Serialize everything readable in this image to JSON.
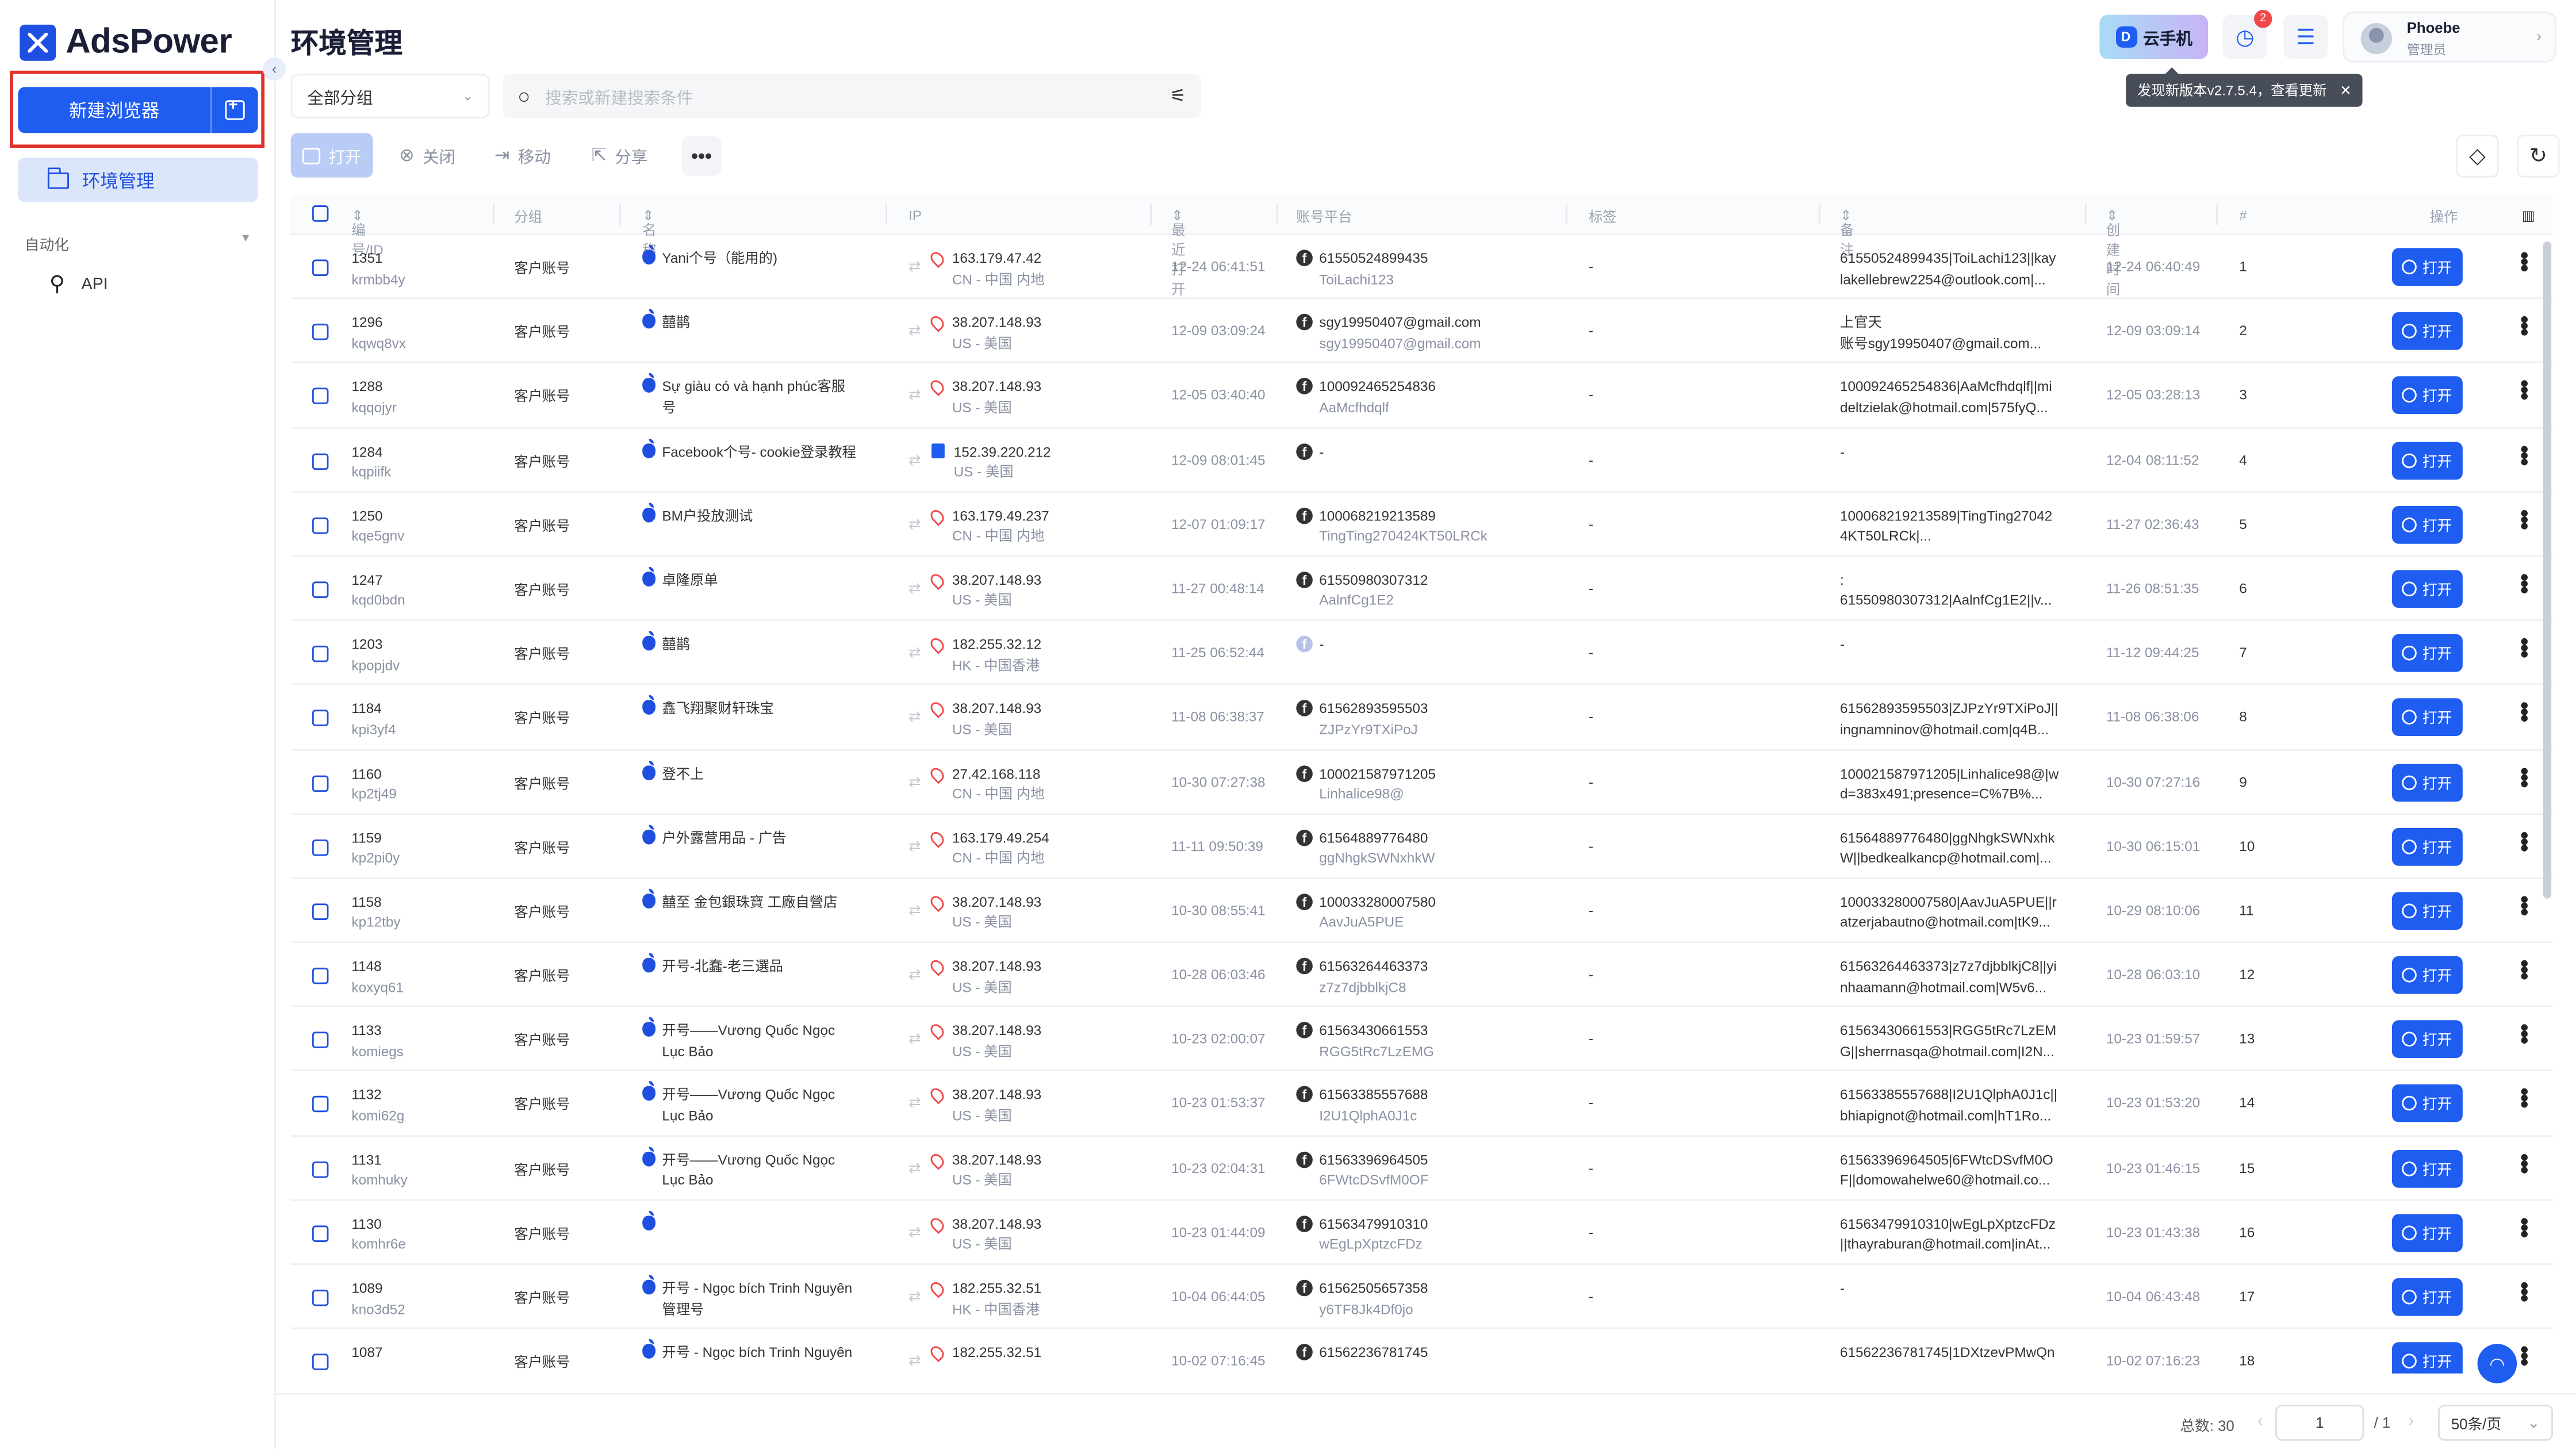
{
  "app": {
    "logo_text": "AdsPower",
    "page_title": "环境管理"
  },
  "sidebar": {
    "new_browser_label": "新建浏览器",
    "env_mgmt_label": "环境管理",
    "automation_label": "自动化",
    "api_label": "API"
  },
  "header": {
    "cloud_phone_label": "云手机",
    "notif_count": "2",
    "user_name": "Phoebe",
    "user_role": "管理员",
    "update_tip": "发现新版本v2.7.5.4，查看更新"
  },
  "filter": {
    "group_select": "全部分组",
    "search_placeholder": "搜索或新建搜索条件"
  },
  "actions": {
    "open": "打开",
    "close": "关闭",
    "move": "移动",
    "share": "分享"
  },
  "columns": {
    "id": "编号/ID",
    "group": "分组",
    "name": "名称",
    "ip": "IP",
    "last_open": "最近打开",
    "account": "账号平台",
    "tag": "标签",
    "note": "备注",
    "created": "创建时间",
    "num": "#",
    "ops": "操作"
  },
  "open_btn_label": "打开",
  "rows": [
    {
      "id": "1351",
      "uid": "krmbb4y",
      "group": "客户账号",
      "name": "Yani个号（能用的)",
      "ip": "163.179.47.42",
      "region": "CN - 中国 内地",
      "last": "12-24 06:41:51",
      "acct": "61550524899435",
      "acct_sub": "ToiLachi123",
      "tag": "-",
      "note1": "61550524899435|ToiLachi123||kay",
      "note2": "lakellebrew2254@outlook.com|...",
      "created": "12-24 06:40:49",
      "num": "1"
    },
    {
      "id": "1296",
      "uid": "kqwq8vx",
      "group": "客户账号",
      "name": "囍鹊",
      "ip": "38.207.148.93",
      "region": "US - 美国",
      "last": "12-09 03:09:24",
      "acct": "sgy19950407@gmail.com",
      "acct_sub": "sgy19950407@gmail.com",
      "tag": "-",
      "note1": "上官天",
      "note2": "账号sgy19950407@gmail.com...",
      "created": "12-09 03:09:14",
      "num": "2"
    },
    {
      "id": "1288",
      "uid": "kqqojyr",
      "group": "客户账号",
      "name": "Sự giàu có và hạnh phúc客服号",
      "ip": "38.207.148.93",
      "region": "US - 美国",
      "last": "12-05 03:40:40",
      "acct": "100092465254836",
      "acct_sub": "AaMcfhdqlf",
      "tag": "-",
      "note1": "100092465254836|AaMcfhdqlf||mi",
      "note2": "deltzielak@hotmail.com|575fyQ...",
      "created": "12-05 03:28:13",
      "num": "3"
    },
    {
      "id": "1284",
      "uid": "kqpiifk",
      "group": "客户账号",
      "name": "Facebook个号- cookie登录教程",
      "ip": "152.39.220.212",
      "region": "US - 美国",
      "last": "12-09 08:01:45",
      "acct": "-",
      "acct_sub": "",
      "tag": "-",
      "note1": "-",
      "note2": "",
      "created": "12-04 08:11:52",
      "num": "4",
      "ipbox": true
    },
    {
      "id": "1250",
      "uid": "kqe5gnv",
      "group": "客户账号",
      "name": "BM户投放测试",
      "ip": "163.179.49.237",
      "region": "CN - 中国 内地",
      "last": "12-07 01:09:17",
      "acct": "100068219213589",
      "acct_sub": "TingTing270424KT50LRCk",
      "tag": "-",
      "note1": "100068219213589|TingTing27042",
      "note2": "4KT50LRCk|...",
      "created": "11-27 02:36:43",
      "num": "5"
    },
    {
      "id": "1247",
      "uid": "kqd0bdn",
      "group": "客户账号",
      "name": "卓隆原单",
      "ip": "38.207.148.93",
      "region": "US - 美国",
      "last": "11-27 00:48:14",
      "acct": "61550980307312",
      "acct_sub": "AalnfCg1E2",
      "tag": "-",
      "note1": ":",
      "note2": "61550980307312|AalnfCg1E2||v...",
      "created": "11-26 08:51:35",
      "num": "6"
    },
    {
      "id": "1203",
      "uid": "kpopjdv",
      "group": "客户账号",
      "name": "囍鹊",
      "ip": "182.255.32.12",
      "region": "HK - 中国香港",
      "last": "11-25 06:52:44",
      "acct": "-",
      "acct_sub": "",
      "tag": "-",
      "note1": "-",
      "note2": "",
      "created": "11-12 09:44:25",
      "num": "7",
      "fbgrey": true
    },
    {
      "id": "1184",
      "uid": "kpi3yf4",
      "group": "客户账号",
      "name": "鑫飞翔聚财轩珠宝",
      "ip": "38.207.148.93",
      "region": "US - 美国",
      "last": "11-08 06:38:37",
      "acct": "61562893595503",
      "acct_sub": "ZJPzYr9TXiPoJ",
      "tag": "-",
      "note1": "61562893595503|ZJPzYr9TXiPoJ||",
      "note2": "ingnamninov@hotmail.com|q4B...",
      "created": "11-08 06:38:06",
      "num": "8"
    },
    {
      "id": "1160",
      "uid": "kp2tj49",
      "group": "客户账号",
      "name": "登不上",
      "ip": "27.42.168.118",
      "region": "CN - 中国 内地",
      "last": "10-30 07:27:38",
      "acct": "100021587971205",
      "acct_sub": "Linhalice98@",
      "tag": "-",
      "note1": "100021587971205|Linhalice98@|w",
      "note2": "d=383x491;presence=C%7B%...",
      "created": "10-30 07:27:16",
      "num": "9"
    },
    {
      "id": "1159",
      "uid": "kp2pi0y",
      "group": "客户账号",
      "name": "户外露营用品 - 广告",
      "ip": "163.179.49.254",
      "region": "CN - 中国 内地",
      "last": "11-11 09:50:39",
      "acct": "61564889776480",
      "acct_sub": "ggNhgkSWNxhkW",
      "tag": "-",
      "note1": "61564889776480|ggNhgkSWNxhk",
      "note2": "W||bedkealkancp@hotmail.com|...",
      "created": "10-30 06:15:01",
      "num": "10"
    },
    {
      "id": "1158",
      "uid": "kp12tby",
      "group": "客户账号",
      "name": "囍至 金包銀珠寶 工廠自營店",
      "ip": "38.207.148.93",
      "region": "US - 美国",
      "last": "10-30 08:55:41",
      "acct": "100033280007580",
      "acct_sub": "AavJuA5PUE",
      "tag": "-",
      "note1": "100033280007580|AavJuA5PUE||r",
      "note2": "atzerjabautno@hotmail.com|tK9...",
      "created": "10-29 08:10:06",
      "num": "11"
    },
    {
      "id": "1148",
      "uid": "koxyq61",
      "group": "客户账号",
      "name": "开号-北蠢-老三選品",
      "ip": "38.207.148.93",
      "region": "US - 美国",
      "last": "10-28 06:03:46",
      "acct": "61563264463373",
      "acct_sub": "z7z7djbblkjC8",
      "tag": "-",
      "note1": "61563264463373|z7z7djbblkjC8||yi",
      "note2": "nhaamann@hotmail.com|W5v6...",
      "created": "10-28 06:03:10",
      "num": "12"
    },
    {
      "id": "1133",
      "uid": "komiegs",
      "group": "客户账号",
      "name": "开号——Vương Quốc Ngọc Lục Bảo",
      "ip": "38.207.148.93",
      "region": "US - 美国",
      "last": "10-23 02:00:07",
      "acct": "61563430661553",
      "acct_sub": "RGG5tRc7LzEMG",
      "tag": "-",
      "note1": "61563430661553|RGG5tRc7LzEM",
      "note2": "G||sherrnasqa@hotmail.com|I2N...",
      "created": "10-23 01:59:57",
      "num": "13"
    },
    {
      "id": "1132",
      "uid": "komi62g",
      "group": "客户账号",
      "name": "开号——Vương Quốc Ngọc Lục Bảo",
      "ip": "38.207.148.93",
      "region": "US - 美国",
      "last": "10-23 01:53:37",
      "acct": "61563385557688",
      "acct_sub": "I2U1QlphA0J1c",
      "tag": "-",
      "note1": "61563385557688|I2U1QlphA0J1c||",
      "note2": "bhiapignot@hotmail.com|hT1Ro...",
      "created": "10-23 01:53:20",
      "num": "14"
    },
    {
      "id": "1131",
      "uid": "komhuky",
      "group": "客户账号",
      "name": "开号——Vương Quốc Ngọc Lục Bảo",
      "ip": "38.207.148.93",
      "region": "US - 美国",
      "last": "10-23 02:04:31",
      "acct": "61563396964505",
      "acct_sub": "6FWtcDSvfM0OF",
      "tag": "-",
      "note1": "61563396964505|6FWtcDSvfM0O",
      "note2": "F||domowahelwe60@hotmail.co...",
      "created": "10-23 01:46:15",
      "num": "15"
    },
    {
      "id": "1130",
      "uid": "komhr6e",
      "group": "客户账号",
      "name": "",
      "ip": "38.207.148.93",
      "region": "US - 美国",
      "last": "10-23 01:44:09",
      "acct": "61563479910310",
      "acct_sub": "wEgLpXptzcFDz",
      "tag": "-",
      "note1": "61563479910310|wEgLpXptzcFDz",
      "note2": "||thayraburan@hotmail.com|inAt...",
      "created": "10-23 01:43:38",
      "num": "16"
    },
    {
      "id": "1089",
      "uid": "kno3d52",
      "group": "客户账号",
      "name": "开号 - Ngọc bích Trinh Nguyên 管理号",
      "ip": "182.255.32.51",
      "region": "HK - 中国香港",
      "last": "10-04 06:44:05",
      "acct": "61562505657358",
      "acct_sub": "y6TF8Jk4Df0jo",
      "tag": "-",
      "note1": "-",
      "note2": "",
      "created": "10-04 06:43:48",
      "num": "17"
    },
    {
      "id": "1087",
      "uid": "",
      "group": "客户账号",
      "name": "开号 - Ngọc bích Trinh Nguyên",
      "ip": "182.255.32.51",
      "region": "",
      "last": "10-02 07:16:45",
      "acct": "61562236781745",
      "acct_sub": "",
      "tag": "",
      "note1": "61562236781745|1DXtzevPMwQn",
      "note2": "",
      "created": "10-02 07:16:23",
      "num": "18"
    }
  ],
  "pagination": {
    "total": "总数: 30",
    "page": "1",
    "of": "/ 1",
    "size": "50条/页"
  }
}
